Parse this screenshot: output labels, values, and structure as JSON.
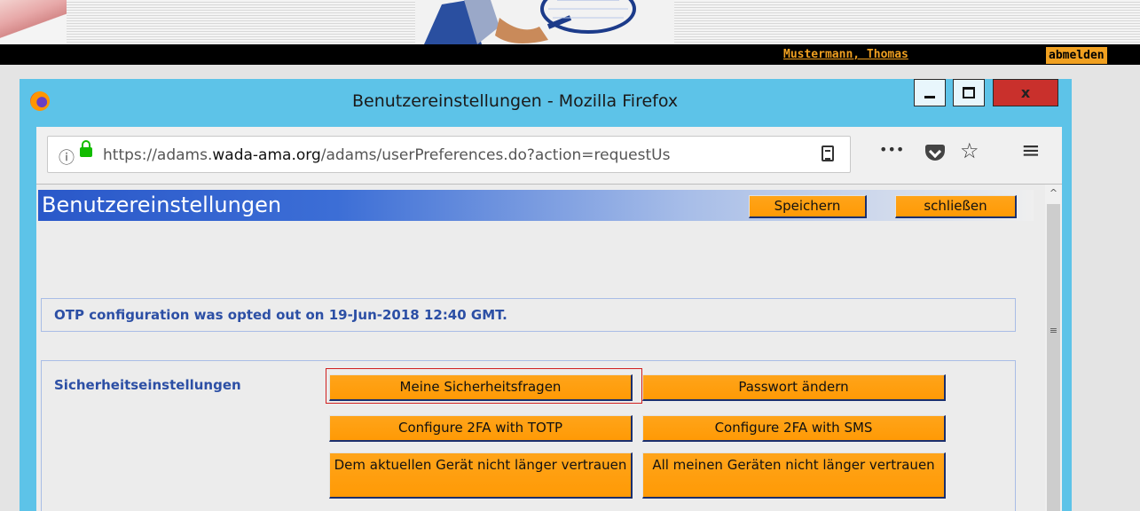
{
  "header": {
    "user_name": "Mustermann, Thomas",
    "logout_label": "abmelden"
  },
  "window": {
    "title": "Benutzereinstellungen - Mozilla Firefox",
    "close_glyph": "x"
  },
  "urlbar": {
    "url_prefix": "https://adams.",
    "url_domain": "wada-ama.org",
    "url_suffix": "/adams/userPreferences.do?action=requestUs",
    "more_glyph": "•••",
    "star_glyph": "☆",
    "menu_glyph": "≡",
    "info_glyph": "ⓘ"
  },
  "page": {
    "title": "Benutzereinstellungen",
    "save_label": "Speichern",
    "close_label": "schließen",
    "notice": "OTP configuration was opted out on 19-Jun-2018 12:40 GMT.",
    "security_label": "Sicherheitseinstellungen",
    "buttons": {
      "security_questions": "Meine Sicherheitsfragen",
      "change_password": "Passwort ändern",
      "totp": "Configure 2FA with TOTP",
      "sms": "Configure 2FA with SMS",
      "untrust_current": "Dem aktuellen Gerät nicht länger vertrauen",
      "untrust_all": "All meinen Geräten nicht länger vertrauen"
    }
  },
  "scrollbar": {
    "up_glyph": "^",
    "grip_glyph": "≡"
  },
  "colors": {
    "accent_orange": "#ff9a05",
    "title_blue": "#2a58c9",
    "window_frame": "#5dc3e8",
    "close_red": "#c9302c"
  }
}
